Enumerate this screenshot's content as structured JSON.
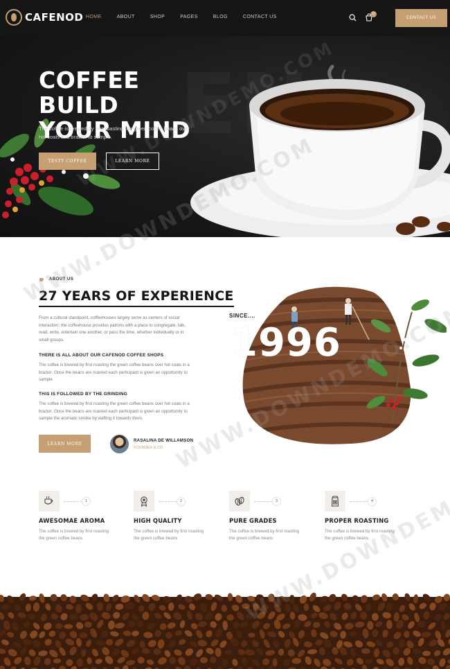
{
  "header": {
    "logo_text": "CAFENOD",
    "nav": [
      "HOME",
      "ABOUT",
      "SHOP",
      "PAGES",
      "BLOG",
      "CONTACT US"
    ],
    "active_nav": "HOME",
    "cart_count": "0",
    "contact_button": "CONTACT US"
  },
  "hero": {
    "title_line1": "COFFEE BUILD",
    "title_line2": "YOUR MIND",
    "description": "The coffee is brewed by first roasting the green coffee beans over hot coals in a brazier to sample.",
    "primary_button": "TESTY COFFEE",
    "secondary_button": "LEARN MORE"
  },
  "about": {
    "tag": "ABOUT US",
    "title": "27 YEARS OF EXPERIENCE",
    "paragraph1": "From a cultural standpoint, coffeehouses largely serve as centers of social interaction: the coffeehouse provides patrons with a place to congregate, talk, read, write, entertain one another, or pass the time, whether individually or in small groups.",
    "subheading1": "THERE IS ALL ABOUT OUR CAFENOD COFFEE SHOPS",
    "paragraph2": "The coffee is brewed by first roasting the green coffee beans over hot coals in a brazier. Once the beans are roasted each participant is given an opportunity to sample",
    "subheading2": "THIS IS FOLLOWED BY THE GRINDING",
    "paragraph3": "The coffee is brewed by first roasting the green coffee beans over hot coals in a brazier. Once the beans are roasted each participant is given an opportunity to sample the aromatic smoke by wafting it towards them.",
    "button": "LEARN MORE",
    "author_name": "RASALINA DE WILLAMSON",
    "author_role": "FOUNDER & CO",
    "since_label": "SINCE....",
    "since_year": "1996"
  },
  "features": [
    {
      "number": "1",
      "title": "AWESOMAE AROMA",
      "desc": "The coffee is brewed by first roasting the green coffee beans",
      "icon": "coffee-cup-icon"
    },
    {
      "number": "2",
      "title": "HIGH QUALITY",
      "desc": "The coffee is brewed by first roasting the green coffee beans",
      "icon": "award-badge-icon"
    },
    {
      "number": "3",
      "title": "PURE GRADES",
      "desc": "The coffee is brewed by first roasting the green coffee beans",
      "icon": "coffee-beans-icon"
    },
    {
      "number": "4",
      "title": "PROPER ROASTING",
      "desc": "The coffee is brewed by first roasting the green coffee beans",
      "icon": "coffee-bag-icon"
    }
  ],
  "watermark": "WWW.DOWNDEMO.COM",
  "colors": {
    "accent": "#c69f73",
    "dark": "#151515",
    "text_muted": "#777777"
  }
}
